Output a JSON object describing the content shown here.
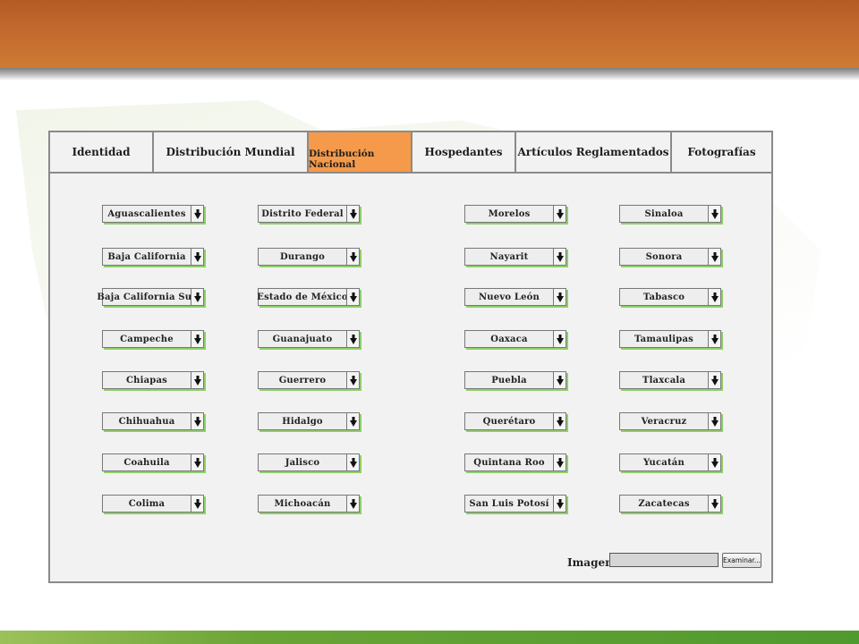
{
  "tabs": [
    {
      "label": "Identidad",
      "active": false
    },
    {
      "label": "Distribución Mundial",
      "active": false
    },
    {
      "label": "Distribución Nacional",
      "active": true
    },
    {
      "label": "Hospedantes",
      "active": false
    },
    {
      "label": "Artículos Reglamentados",
      "active": false
    },
    {
      "label": "Fotografías",
      "active": false
    }
  ],
  "states": [
    [
      "Aguascalientes",
      "Baja California",
      "Baja California Sur",
      "Campeche",
      "Chiapas",
      "Chihuahua",
      "Coahuila",
      "Colima"
    ],
    [
      "Distrito Federal",
      "Durango",
      "Estado de México",
      "Guanajuato",
      "Guerrero",
      "Hidalgo",
      "Jalisco",
      "Michoacán"
    ],
    [
      "Morelos",
      "Nayarit",
      "Nuevo León",
      "Oaxaca",
      "Puebla",
      "Querétaro",
      "Quintana Roo",
      "San Luis Potosí"
    ],
    [
      "Sinaloa",
      "Sonora",
      "Tabasco",
      "Tamaulipas",
      "Tlaxcala",
      "Veracruz",
      "Yucatán",
      "Zacatecas"
    ]
  ],
  "image_upload": {
    "label": "Imagen",
    "value": "",
    "button_label": "Examinar..."
  },
  "colors": {
    "header": "#c26a2f",
    "active_tab": "#f59a4a",
    "footer": "#5aa232",
    "dropdown_shadow": "#8ecf6a"
  }
}
